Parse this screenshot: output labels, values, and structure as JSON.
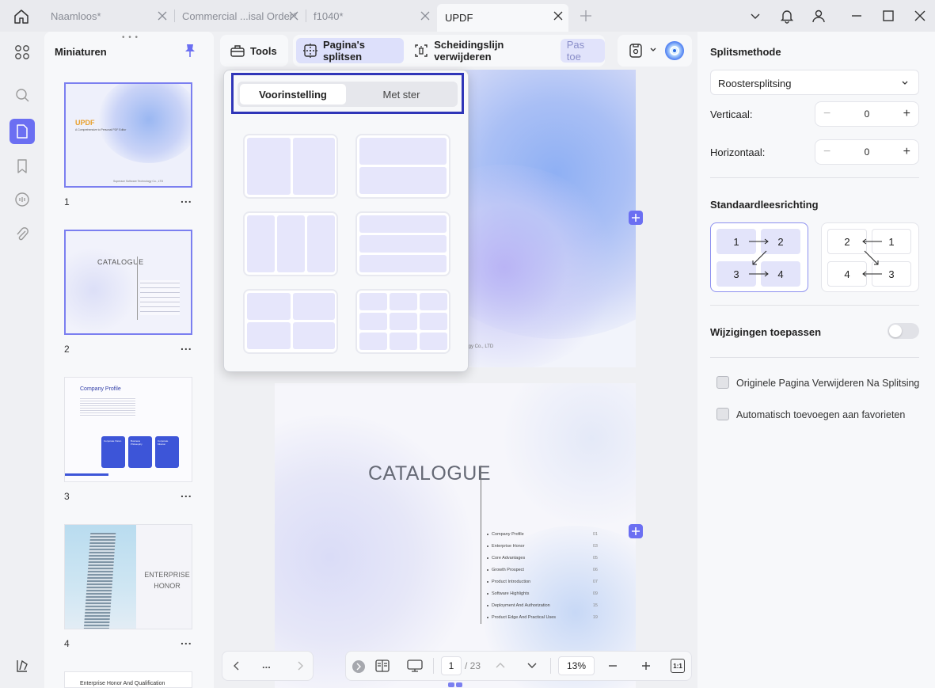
{
  "tabs": [
    {
      "label": "Naamloos*"
    },
    {
      "label": "Commercial ...isal Order*"
    },
    {
      "label": "f1040*"
    },
    {
      "label": "UPDF"
    }
  ],
  "thumbnails": {
    "title": "Miniaturen",
    "pages": [
      {
        "number": "1",
        "brand": "UPDF",
        "subtitle": "A Comprehensive to Personal PDF Editor",
        "footer": "Superace Software Technology Co., LTD"
      },
      {
        "number": "2",
        "heading": "CATALOGUE"
      },
      {
        "number": "3",
        "heading": "Company Profile",
        "cards": [
          "Corporate Vision",
          "Business Philosophy",
          "Corporate Mission"
        ]
      },
      {
        "number": "4",
        "heading_line1": "ENTERPRISE",
        "heading_line2": "HONOR"
      },
      {
        "number": "5",
        "heading": "Enterprise Honor And Qualification"
      }
    ],
    "more": "..."
  },
  "toolbar": {
    "tools": "Tools",
    "split_pages": "Pagina's splitsen",
    "remove_divider": "Scheidingslijn verwijderen",
    "apply": "Pas toe"
  },
  "popup": {
    "tab_preset": "Voorinstelling",
    "tab_starred": "Met ster"
  },
  "document": {
    "page1_footer": "logy Co., LTD",
    "catalogue_title": "CATALOGUE",
    "toc": [
      {
        "label": "Company Profile",
        "page": "01"
      },
      {
        "label": "Enterprise Honor",
        "page": "03"
      },
      {
        "label": "Core Advantages",
        "page": "05"
      },
      {
        "label": "Growth Prospect",
        "page": "06"
      },
      {
        "label": "Product Introduction",
        "page": "07"
      },
      {
        "label": "Software Highlights",
        "page": "09"
      },
      {
        "label": "Deployment And Authorization",
        "page": "15"
      },
      {
        "label": "Product Edge And Practical Uses",
        "page": "19"
      }
    ]
  },
  "bottombar": {
    "more": "...",
    "current_page": "1",
    "total_pages": "/ 23",
    "zoom": "13%",
    "fit_label": "1:1"
  },
  "right_panel": {
    "split_method_title": "Splitsmethode",
    "split_method_value": "Roostersplitsing",
    "vertical_label": "Verticaal:",
    "vertical_value": "0",
    "horizontal_label": "Horizontaal:",
    "horizontal_value": "0",
    "reading_dir_title": "Standaardleesrichting",
    "dir_ltr": [
      "1",
      "2",
      "3",
      "4"
    ],
    "dir_rtl": [
      "2",
      "1",
      "4",
      "3"
    ],
    "apply_changes_label": "Wijzigingen toepassen",
    "apply_changes_on": false,
    "opt_delete_original": "Originele Pagina Verwijderen Na Splitsing",
    "opt_delete_original_checked": false,
    "opt_add_favorites": "Automatisch toevoegen aan favorieten",
    "opt_add_favorites_checked": false
  },
  "colors": {
    "accent": "#6b6ff2",
    "highlight_border": "#2f35b8"
  }
}
